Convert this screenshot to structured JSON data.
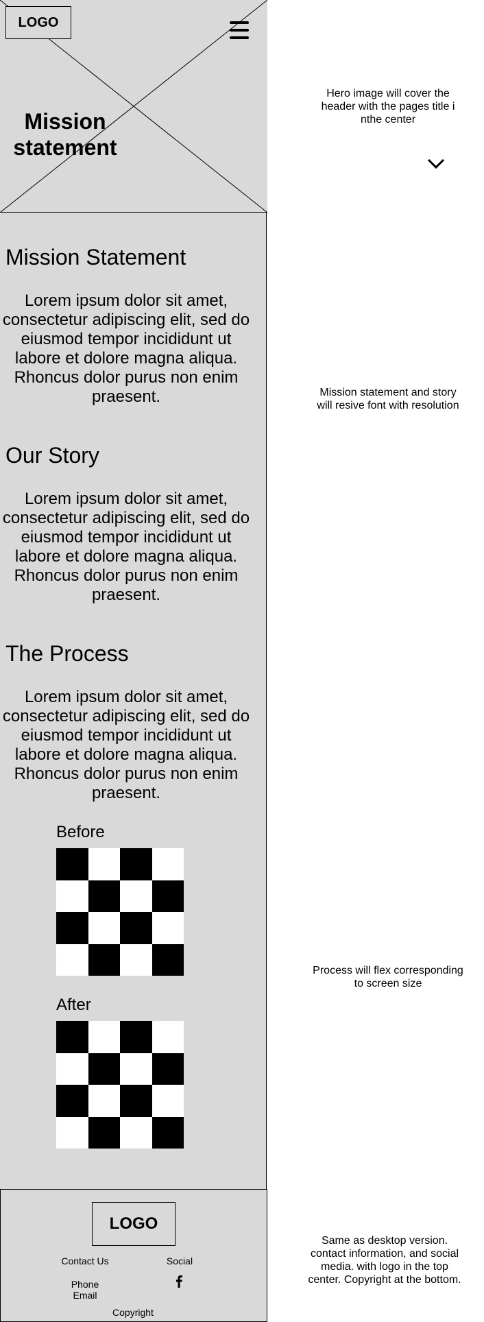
{
  "hero": {
    "logo": "LOGO",
    "title_line1": "Mission",
    "title_line2": "statement"
  },
  "sections": [
    {
      "heading": "Mission Statement",
      "body": "Lorem ipsum dolor sit amet, consectetur adipiscing elit, sed do eiusmod tempor incididunt ut labore et dolore magna aliqua. Rhoncus dolor purus non enim praesent."
    },
    {
      "heading": "Our Story",
      "body": "Lorem ipsum dolor sit amet, consectetur adipiscing elit, sed do eiusmod tempor incididunt ut labore et dolore magna aliqua. Rhoncus dolor purus non enim praesent."
    },
    {
      "heading": "The Process",
      "body": "Lorem ipsum dolor sit amet, consectetur adipiscing elit, sed do eiusmod tempor incididunt ut labore et dolore magna aliqua. Rhoncus dolor purus non enim praesent."
    }
  ],
  "process": {
    "before_label": "Before",
    "after_label": "After"
  },
  "footer": {
    "logo": "LOGO",
    "contact_label": "Contact Us",
    "social_label": "Social",
    "phone": "Phone",
    "email": "Email",
    "copyright": "Copyright",
    "social_icon": "facebook-icon"
  },
  "notes": {
    "hero_l1": "Hero image will cover the",
    "hero_l2": "header with the pages title i",
    "hero_l3": "nthe center",
    "mission_l1": "Mission statement and story",
    "mission_l2": "will resive font with resolution",
    "process_l1": "Process will flex corresponding",
    "process_l2": "to screen size",
    "footer_l1": "Same as desktop version.",
    "footer_l2": "contact information, and social",
    "footer_l3": "media. with logo in the top",
    "footer_l4": "center. Copyright at the bottom."
  },
  "icons": {
    "menu": "hamburger-menu-icon",
    "scroll": "chevron-down-icon"
  },
  "colors": {
    "placeholder_gray": "#d9d9d9",
    "ink": "#000000"
  }
}
